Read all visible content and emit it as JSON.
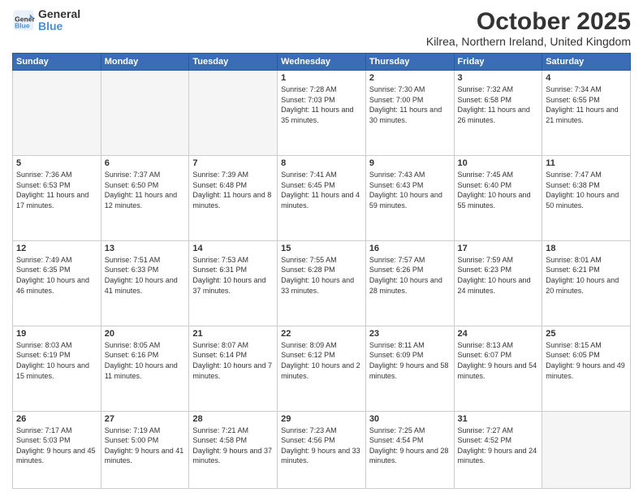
{
  "header": {
    "logo_line1": "General",
    "logo_line2": "Blue",
    "month": "October 2025",
    "location": "Kilrea, Northern Ireland, United Kingdom"
  },
  "weekdays": [
    "Sunday",
    "Monday",
    "Tuesday",
    "Wednesday",
    "Thursday",
    "Friday",
    "Saturday"
  ],
  "weeks": [
    [
      {
        "day": "",
        "sunrise": "",
        "sunset": "",
        "daylight": "",
        "empty": true
      },
      {
        "day": "",
        "sunrise": "",
        "sunset": "",
        "daylight": "",
        "empty": true
      },
      {
        "day": "",
        "sunrise": "",
        "sunset": "",
        "daylight": "",
        "empty": true
      },
      {
        "day": "1",
        "sunrise": "Sunrise: 7:28 AM",
        "sunset": "Sunset: 7:03 PM",
        "daylight": "Daylight: 11 hours and 35 minutes."
      },
      {
        "day": "2",
        "sunrise": "Sunrise: 7:30 AM",
        "sunset": "Sunset: 7:00 PM",
        "daylight": "Daylight: 11 hours and 30 minutes."
      },
      {
        "day": "3",
        "sunrise": "Sunrise: 7:32 AM",
        "sunset": "Sunset: 6:58 PM",
        "daylight": "Daylight: 11 hours and 26 minutes."
      },
      {
        "day": "4",
        "sunrise": "Sunrise: 7:34 AM",
        "sunset": "Sunset: 6:55 PM",
        "daylight": "Daylight: 11 hours and 21 minutes."
      }
    ],
    [
      {
        "day": "5",
        "sunrise": "Sunrise: 7:36 AM",
        "sunset": "Sunset: 6:53 PM",
        "daylight": "Daylight: 11 hours and 17 minutes."
      },
      {
        "day": "6",
        "sunrise": "Sunrise: 7:37 AM",
        "sunset": "Sunset: 6:50 PM",
        "daylight": "Daylight: 11 hours and 12 minutes."
      },
      {
        "day": "7",
        "sunrise": "Sunrise: 7:39 AM",
        "sunset": "Sunset: 6:48 PM",
        "daylight": "Daylight: 11 hours and 8 minutes."
      },
      {
        "day": "8",
        "sunrise": "Sunrise: 7:41 AM",
        "sunset": "Sunset: 6:45 PM",
        "daylight": "Daylight: 11 hours and 4 minutes."
      },
      {
        "day": "9",
        "sunrise": "Sunrise: 7:43 AM",
        "sunset": "Sunset: 6:43 PM",
        "daylight": "Daylight: 10 hours and 59 minutes."
      },
      {
        "day": "10",
        "sunrise": "Sunrise: 7:45 AM",
        "sunset": "Sunset: 6:40 PM",
        "daylight": "Daylight: 10 hours and 55 minutes."
      },
      {
        "day": "11",
        "sunrise": "Sunrise: 7:47 AM",
        "sunset": "Sunset: 6:38 PM",
        "daylight": "Daylight: 10 hours and 50 minutes."
      }
    ],
    [
      {
        "day": "12",
        "sunrise": "Sunrise: 7:49 AM",
        "sunset": "Sunset: 6:35 PM",
        "daylight": "Daylight: 10 hours and 46 minutes."
      },
      {
        "day": "13",
        "sunrise": "Sunrise: 7:51 AM",
        "sunset": "Sunset: 6:33 PM",
        "daylight": "Daylight: 10 hours and 41 minutes."
      },
      {
        "day": "14",
        "sunrise": "Sunrise: 7:53 AM",
        "sunset": "Sunset: 6:31 PM",
        "daylight": "Daylight: 10 hours and 37 minutes."
      },
      {
        "day": "15",
        "sunrise": "Sunrise: 7:55 AM",
        "sunset": "Sunset: 6:28 PM",
        "daylight": "Daylight: 10 hours and 33 minutes."
      },
      {
        "day": "16",
        "sunrise": "Sunrise: 7:57 AM",
        "sunset": "Sunset: 6:26 PM",
        "daylight": "Daylight: 10 hours and 28 minutes."
      },
      {
        "day": "17",
        "sunrise": "Sunrise: 7:59 AM",
        "sunset": "Sunset: 6:23 PM",
        "daylight": "Daylight: 10 hours and 24 minutes."
      },
      {
        "day": "18",
        "sunrise": "Sunrise: 8:01 AM",
        "sunset": "Sunset: 6:21 PM",
        "daylight": "Daylight: 10 hours and 20 minutes."
      }
    ],
    [
      {
        "day": "19",
        "sunrise": "Sunrise: 8:03 AM",
        "sunset": "Sunset: 6:19 PM",
        "daylight": "Daylight: 10 hours and 15 minutes."
      },
      {
        "day": "20",
        "sunrise": "Sunrise: 8:05 AM",
        "sunset": "Sunset: 6:16 PM",
        "daylight": "Daylight: 10 hours and 11 minutes."
      },
      {
        "day": "21",
        "sunrise": "Sunrise: 8:07 AM",
        "sunset": "Sunset: 6:14 PM",
        "daylight": "Daylight: 10 hours and 7 minutes."
      },
      {
        "day": "22",
        "sunrise": "Sunrise: 8:09 AM",
        "sunset": "Sunset: 6:12 PM",
        "daylight": "Daylight: 10 hours and 2 minutes."
      },
      {
        "day": "23",
        "sunrise": "Sunrise: 8:11 AM",
        "sunset": "Sunset: 6:09 PM",
        "daylight": "Daylight: 9 hours and 58 minutes."
      },
      {
        "day": "24",
        "sunrise": "Sunrise: 8:13 AM",
        "sunset": "Sunset: 6:07 PM",
        "daylight": "Daylight: 9 hours and 54 minutes."
      },
      {
        "day": "25",
        "sunrise": "Sunrise: 8:15 AM",
        "sunset": "Sunset: 6:05 PM",
        "daylight": "Daylight: 9 hours and 49 minutes."
      }
    ],
    [
      {
        "day": "26",
        "sunrise": "Sunrise: 7:17 AM",
        "sunset": "Sunset: 5:03 PM",
        "daylight": "Daylight: 9 hours and 45 minutes."
      },
      {
        "day": "27",
        "sunrise": "Sunrise: 7:19 AM",
        "sunset": "Sunset: 5:00 PM",
        "daylight": "Daylight: 9 hours and 41 minutes."
      },
      {
        "day": "28",
        "sunrise": "Sunrise: 7:21 AM",
        "sunset": "Sunset: 4:58 PM",
        "daylight": "Daylight: 9 hours and 37 minutes."
      },
      {
        "day": "29",
        "sunrise": "Sunrise: 7:23 AM",
        "sunset": "Sunset: 4:56 PM",
        "daylight": "Daylight: 9 hours and 33 minutes."
      },
      {
        "day": "30",
        "sunrise": "Sunrise: 7:25 AM",
        "sunset": "Sunset: 4:54 PM",
        "daylight": "Daylight: 9 hours and 28 minutes."
      },
      {
        "day": "31",
        "sunrise": "Sunrise: 7:27 AM",
        "sunset": "Sunset: 4:52 PM",
        "daylight": "Daylight: 9 hours and 24 minutes."
      },
      {
        "day": "",
        "sunrise": "",
        "sunset": "",
        "daylight": "",
        "empty": true
      }
    ]
  ]
}
